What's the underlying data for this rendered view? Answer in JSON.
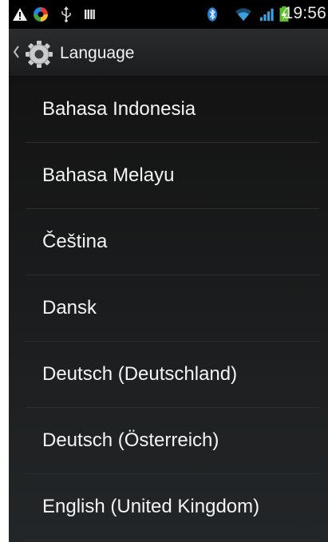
{
  "status_bar": {
    "time": "19:56",
    "icons": [
      "warning-icon",
      "sync-app-icon",
      "usb-icon",
      "storage-icon",
      "bluetooth-icon",
      "wifi-icon",
      "signal-icon",
      "battery-charging-icon"
    ]
  },
  "action_bar": {
    "title": "Language",
    "back_icon": "chevron-left-icon",
    "app_icon": "settings-gear-icon"
  },
  "languages": [
    "Bahasa Indonesia",
    "Bahasa Melayu",
    "Čeština",
    "Dansk",
    "Deutsch (Deutschland)",
    "Deutsch (Österreich)",
    "English (United Kingdom)"
  ],
  "colors": {
    "background": "#141414",
    "text": "#f4f4f4",
    "divider": "#2c2f31",
    "bluetooth": "#2a7fd4",
    "wifi": "#3aa0e0",
    "battery": "#5fbf2a"
  }
}
